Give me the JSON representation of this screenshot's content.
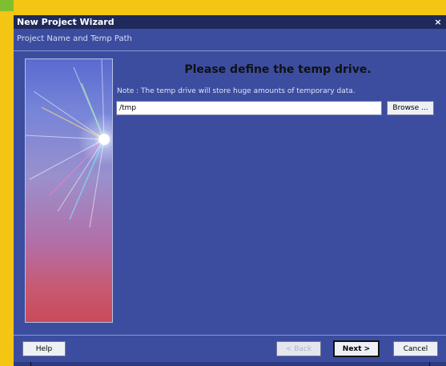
{
  "window": {
    "title": "New Project Wizard",
    "close_glyph": "×"
  },
  "subheader": "Project Name and Temp Path",
  "main": {
    "heading": "Please define the temp drive.",
    "note": "Note : The temp drive will store huge amounts of temporary data.",
    "path_value": "/tmp",
    "browse_label": "Browse ..."
  },
  "footer": {
    "help_label": "Help",
    "back_label": "< Back",
    "next_label": "Next >",
    "cancel_label": "Cancel"
  },
  "icons": {
    "close": "close-icon"
  },
  "colors": {
    "window_bg": "#3c4da0",
    "title_bg": "#1f2a5a",
    "outer_bg": "#f4c512"
  }
}
